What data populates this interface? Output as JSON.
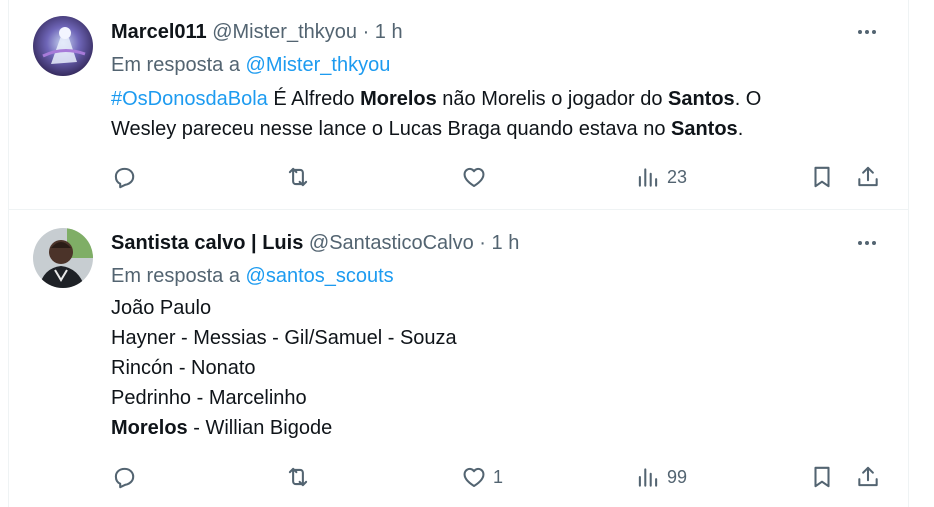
{
  "tweets": [
    {
      "display_name": "Marcel011",
      "handle": "@Mister_thkyou",
      "separator": "·",
      "time": "1 h",
      "reply_prefix": "Em resposta a",
      "reply_handle": "@Mister_thkyou",
      "body_lines": [
        [
          {
            "text": "#OsDonosdaBola",
            "style": "link"
          },
          {
            "text": " É Alfredo ",
            "style": "plain"
          },
          {
            "text": "Morelos",
            "style": "bold"
          },
          {
            "text": " não Morelis o jogador do ",
            "style": "plain"
          },
          {
            "text": "Santos",
            "style": "bold"
          },
          {
            "text": ". O",
            "style": "plain"
          }
        ],
        [
          {
            "text": "Wesley pareceu nesse lance o Lucas Braga quando estava no ",
            "style": "plain"
          },
          {
            "text": "Santos",
            "style": "bold"
          },
          {
            "text": ".",
            "style": "plain"
          }
        ]
      ],
      "actions": {
        "reply": "",
        "retweet": "",
        "like": "",
        "views": "23"
      }
    },
    {
      "display_name": "Santista calvo | Luis",
      "handle": "@SantasticoCalvo",
      "separator": "·",
      "time": "1 h",
      "reply_prefix": "Em resposta a",
      "reply_handle": "@santos_scouts",
      "body_lines": [
        [
          {
            "text": "João Paulo",
            "style": "plain"
          }
        ],
        [
          {
            "text": "Hayner - Messias - Gil/Samuel - Souza",
            "style": "plain"
          }
        ],
        [
          {
            "text": "Rincón - Nonato",
            "style": "plain"
          }
        ],
        [
          {
            "text": "Pedrinho - Marcelinho",
            "style": "plain"
          }
        ],
        [
          {
            "text": "Morelos",
            "style": "bold"
          },
          {
            "text": " - Willian Bigode",
            "style": "plain"
          }
        ]
      ],
      "actions": {
        "reply": "",
        "retweet": "",
        "like": "1",
        "views": "99"
      }
    }
  ],
  "icons": [
    "more-icon",
    "reply-icon",
    "retweet-icon",
    "like-icon",
    "views-icon",
    "bookmark-icon",
    "share-icon"
  ],
  "colors": {
    "link": "#1d9bf0",
    "secondary_text": "#536471",
    "primary_text": "#0f1419",
    "divider": "#eff3f4"
  }
}
